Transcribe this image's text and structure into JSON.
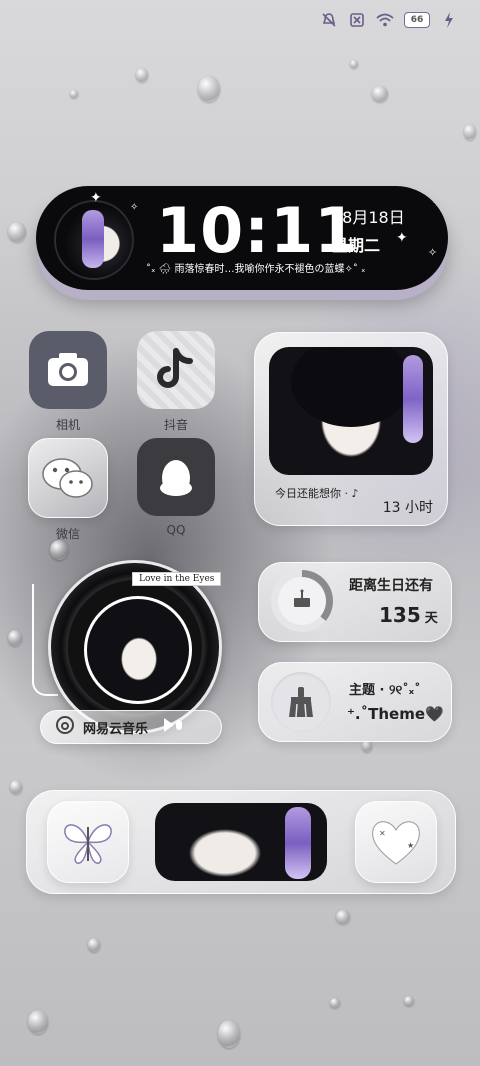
{
  "status_bar": {
    "battery": "66"
  },
  "clock": {
    "time": "10:11",
    "date": "08月18日",
    "weekday": "星期二",
    "lyric": "˚ₓ 🌧 雨落惊春时…我喻你作永不褪色の蓝蝶✧˚ ₓ"
  },
  "apps": [
    {
      "label": "相机",
      "icon": "camera-icon"
    },
    {
      "label": "抖音",
      "icon": "tiktok-icon"
    },
    {
      "label": "微信",
      "icon": "wechat-icon"
    },
    {
      "label": "QQ",
      "icon": "qq-penguin-icon"
    }
  ],
  "photo_widget": {
    "caption": "今日还能想你 · ♪",
    "hours": "13 小时"
  },
  "music_widget": {
    "tag": "Love in the Eyes",
    "app_name": "网易云音乐"
  },
  "birthday_widget": {
    "title": "距离生日还有",
    "days": "135",
    "unit": "天",
    "progress": 0.36
  },
  "theme_widget": {
    "line1": "主题 · ୨୧˚ₓ˚",
    "line2": "⁺.˚Theme🖤"
  },
  "dock": {
    "items": [
      "butterfly-icon",
      "portrait-banner",
      "heart-icon"
    ]
  }
}
